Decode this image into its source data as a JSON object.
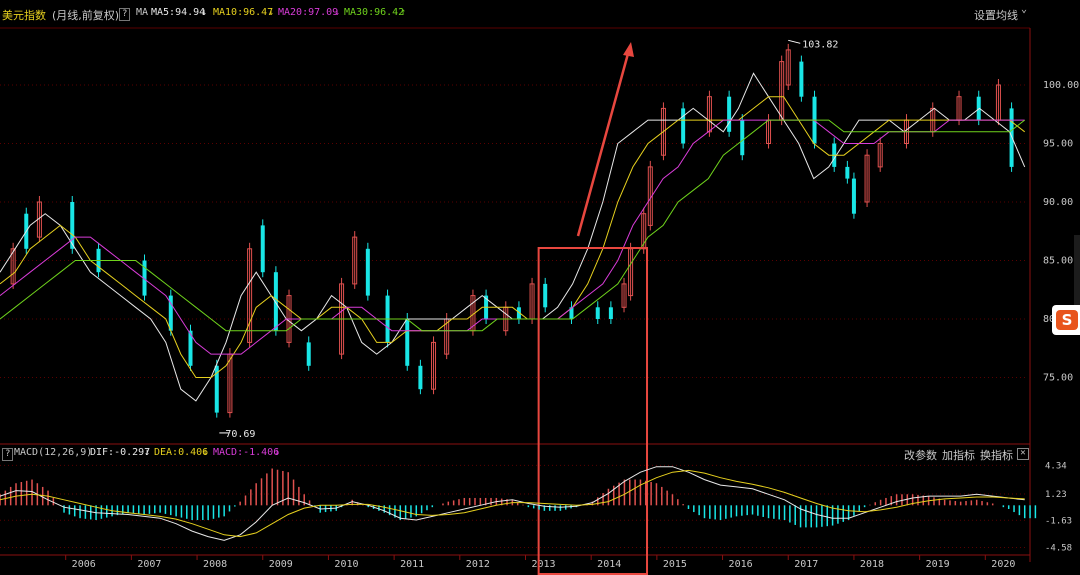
{
  "header": {
    "title": "美元指数",
    "subtitle": "(月线,前复权)",
    "help": "?",
    "ma_label": "MA",
    "ma5": "MA5:94.94",
    "ma10": "MA10:96.47",
    "ma20": "MA20:97.09",
    "ma30": "MA30:96.42",
    "ma5_arrow": "↓",
    "ma10_arrow": "↓",
    "ma20_arrow": "↓",
    "ma30_arrow": "↑",
    "settings": "设置均线",
    "settings_arrow": "⌄"
  },
  "macd_header": {
    "help": "?",
    "label": "MACD(12,26,9)",
    "dif": "DIF:-0.297",
    "dea": "DEA:0.406",
    "macd": "MACD:-1.406",
    "dif_arrow": "↓",
    "dea_arrow": "↓",
    "macd_arrow": "↓",
    "btn_params": "改参数",
    "btn_add": "加指标",
    "btn_swap": "换指标",
    "close": "✕"
  },
  "colors": {
    "up": "#e0514f",
    "down": "#19e6e6",
    "ma5": "#e8e8e8",
    "ma10": "#e6d01e",
    "ma20": "#d83cd8",
    "ma30": "#6fd21c",
    "dif": "#e8e8e8",
    "dea": "#e6d01e",
    "annotation": "#e8473f",
    "grid": "#5a0000",
    "text": "#c8c8c8"
  },
  "chart_data": [
    {
      "type": "candlestick",
      "title": "美元指数 (月线,前复权)",
      "yticks": [
        75.0,
        80.0,
        85.0,
        90.0,
        95.0,
        100.0
      ],
      "ytick_labels": [
        "75.00",
        "80.",
        "85.00",
        "90.00",
        "95.00",
        "100.00"
      ],
      "xticks": [
        "2006",
        "2007",
        "2008",
        "2009",
        "2010",
        "2011",
        "2012",
        "2013",
        "2014",
        "2015",
        "2016",
        "2017",
        "2018",
        "2019",
        "2020"
      ],
      "annotations": [
        {
          "label": "70.69",
          "kind": "low"
        },
        {
          "label": "103.82",
          "kind": "high"
        }
      ],
      "series": [
        {
          "name": "MA5",
          "values": [
            84,
            86,
            88,
            89,
            88,
            86,
            84,
            83,
            82,
            81,
            80,
            78,
            74,
            73,
            75,
            78,
            82,
            84,
            82,
            80,
            79,
            80,
            82,
            81,
            78,
            77,
            78,
            80,
            80,
            80,
            80,
            81,
            82,
            81,
            80,
            80,
            80,
            81,
            83,
            86,
            90,
            95,
            96,
            97,
            97,
            97,
            98,
            97,
            96,
            98,
            101,
            99,
            97,
            95,
            92,
            93,
            95,
            97,
            97,
            97,
            96,
            97,
            98,
            97,
            97,
            98,
            97,
            96,
            93
          ]
        },
        {
          "name": "MA10",
          "values": [
            83,
            84,
            86,
            87,
            88,
            87,
            85,
            84,
            83,
            82,
            81,
            80,
            77,
            75,
            75,
            76,
            78,
            81,
            82,
            81,
            80,
            80,
            81,
            81,
            80,
            78,
            78,
            79,
            79,
            79,
            80,
            80,
            81,
            81,
            81,
            80,
            80,
            80,
            81,
            83,
            86,
            90,
            93,
            95,
            96,
            97,
            97,
            97,
            97,
            97,
            98,
            99,
            99,
            97,
            95,
            94,
            94,
            95,
            96,
            97,
            97,
            97,
            97,
            97,
            97,
            97,
            97,
            97,
            96
          ]
        },
        {
          "name": "MA20",
          "values": [
            82,
            83,
            84,
            85,
            86,
            87,
            87,
            86,
            85,
            84,
            83,
            82,
            80,
            78,
            77,
            77,
            77,
            78,
            79,
            80,
            80,
            80,
            80,
            81,
            81,
            80,
            79,
            79,
            79,
            79,
            79,
            79,
            80,
            80,
            80,
            80,
            80,
            80,
            81,
            82,
            83,
            85,
            88,
            90,
            92,
            93,
            95,
            96,
            97,
            97,
            97,
            97,
            97,
            97,
            97,
            96,
            95,
            95,
            95,
            96,
            96,
            96,
            96,
            97,
            97,
            97,
            97,
            97,
            97
          ]
        },
        {
          "name": "MA30",
          "values": [
            80,
            81,
            82,
            83,
            84,
            85,
            85,
            85,
            85,
            85,
            84,
            83,
            82,
            81,
            80,
            79,
            79,
            79,
            79,
            79,
            80,
            80,
            80,
            80,
            80,
            80,
            80,
            80,
            79,
            79,
            79,
            79,
            79,
            80,
            80,
            80,
            80,
            80,
            80,
            81,
            82,
            83,
            85,
            87,
            88,
            90,
            91,
            92,
            94,
            95,
            96,
            97,
            97,
            97,
            97,
            97,
            96,
            96,
            96,
            96,
            96,
            96,
            96,
            96,
            96,
            96,
            96,
            96,
            97
          ]
        }
      ],
      "candles_up": [
        {
          "x": 2005.2,
          "o": 83,
          "c": 86
        },
        {
          "x": 2005.6,
          "o": 87,
          "c": 90
        },
        {
          "x": 2008.5,
          "o": 72,
          "c": 77
        },
        {
          "x": 2008.8,
          "o": 78,
          "c": 86
        },
        {
          "x": 2009.4,
          "o": 78,
          "c": 82
        },
        {
          "x": 2010.2,
          "o": 77,
          "c": 83
        },
        {
          "x": 2010.4,
          "o": 83,
          "c": 87
        },
        {
          "x": 2011.6,
          "o": 74,
          "c": 78
        },
        {
          "x": 2011.8,
          "o": 77,
          "c": 80
        },
        {
          "x": 2012.2,
          "o": 79,
          "c": 82
        },
        {
          "x": 2012.7,
          "o": 79,
          "c": 81
        },
        {
          "x": 2013.1,
          "o": 80,
          "c": 83
        },
        {
          "x": 2014.5,
          "o": 81,
          "c": 83
        },
        {
          "x": 2014.6,
          "o": 82,
          "c": 86
        },
        {
          "x": 2014.8,
          "o": 86,
          "c": 89
        },
        {
          "x": 2014.9,
          "o": 88,
          "c": 93
        },
        {
          "x": 2015.1,
          "o": 94,
          "c": 98
        },
        {
          "x": 2015.8,
          "o": 96,
          "c": 99
        },
        {
          "x": 2016.7,
          "o": 95,
          "c": 97
        },
        {
          "x": 2016.9,
          "o": 97,
          "c": 102
        },
        {
          "x": 2017.0,
          "o": 100,
          "c": 103
        },
        {
          "x": 2018.2,
          "o": 90,
          "c": 94
        },
        {
          "x": 2018.4,
          "o": 93,
          "c": 95
        },
        {
          "x": 2018.8,
          "o": 95,
          "c": 97
        },
        {
          "x": 2019.2,
          "o": 96,
          "c": 98
        },
        {
          "x": 2019.6,
          "o": 97,
          "c": 99
        },
        {
          "x": 2020.2,
          "o": 97,
          "c": 100
        }
      ],
      "candles_down": [
        {
          "x": 2005.4,
          "o": 89,
          "c": 86
        },
        {
          "x": 2006.1,
          "o": 90,
          "c": 86
        },
        {
          "x": 2006.5,
          "o": 86,
          "c": 84
        },
        {
          "x": 2007.2,
          "o": 85,
          "c": 82
        },
        {
          "x": 2007.6,
          "o": 82,
          "c": 79
        },
        {
          "x": 2007.9,
          "o": 79,
          "c": 76
        },
        {
          "x": 2008.3,
          "o": 76,
          "c": 72
        },
        {
          "x": 2009.0,
          "o": 88,
          "c": 84
        },
        {
          "x": 2009.2,
          "o": 84,
          "c": 79
        },
        {
          "x": 2009.7,
          "o": 78,
          "c": 76
        },
        {
          "x": 2010.6,
          "o": 86,
          "c": 82
        },
        {
          "x": 2010.9,
          "o": 82,
          "c": 78
        },
        {
          "x": 2011.2,
          "o": 80,
          "c": 76
        },
        {
          "x": 2011.4,
          "o": 76,
          "c": 74
        },
        {
          "x": 2012.4,
          "o": 82,
          "c": 80
        },
        {
          "x": 2012.9,
          "o": 81,
          "c": 80
        },
        {
          "x": 2013.3,
          "o": 83,
          "c": 81
        },
        {
          "x": 2013.7,
          "o": 81,
          "c": 80
        },
        {
          "x": 2014.1,
          "o": 81,
          "c": 80
        },
        {
          "x": 2014.3,
          "o": 81,
          "c": 80
        },
        {
          "x": 2015.4,
          "o": 98,
          "c": 95
        },
        {
          "x": 2016.1,
          "o": 99,
          "c": 96
        },
        {
          "x": 2016.3,
          "o": 97,
          "c": 94
        },
        {
          "x": 2017.2,
          "o": 102,
          "c": 99
        },
        {
          "x": 2017.4,
          "o": 99,
          "c": 95
        },
        {
          "x": 2017.7,
          "o": 95,
          "c": 93
        },
        {
          "x": 2017.9,
          "o": 93,
          "c": 92
        },
        {
          "x": 2018.0,
          "o": 92,
          "c": 89
        },
        {
          "x": 2019.9,
          "o": 99,
          "c": 97
        },
        {
          "x": 2020.4,
          "o": 98,
          "c": 93
        }
      ],
      "ma_x_start": 2005.0,
      "ma_x_end": 2020.6
    },
    {
      "type": "macd",
      "title": "MACD(12,26,9)",
      "yticks": [
        4.34,
        1.23,
        -1.63,
        -4.58
      ],
      "ytick_labels": [
        "4.34",
        "1.23",
        "-1.63",
        "-4.58"
      ],
      "dif": [
        1.0,
        1.6,
        1.5,
        0.6,
        -0.2,
        -0.5,
        -0.8,
        -0.9,
        -1.0,
        -1.2,
        -1.4,
        -2.0,
        -2.8,
        -3.4,
        -3.8,
        -3.2,
        -1.8,
        0.0,
        0.8,
        0.3,
        -0.4,
        -0.3,
        0.4,
        0.0,
        -0.6,
        -1.4,
        -1.6,
        -1.2,
        -0.8,
        -0.4,
        0.0,
        0.4,
        0.6,
        0.2,
        -0.1,
        -0.2,
        -0.1,
        0.3,
        1.3,
        2.6,
        3.6,
        4.2,
        4.2,
        3.6,
        2.8,
        2.2,
        2.0,
        1.8,
        1.2,
        0.6,
        -0.4,
        -1.0,
        -1.4,
        -1.4,
        -0.8,
        -0.2,
        0.4,
        0.8,
        1.0,
        1.0,
        1.0,
        1.2,
        1.0,
        0.8,
        0.6
      ],
      "dea": [
        0.6,
        1.0,
        1.2,
        1.0,
        0.6,
        0.2,
        -0.2,
        -0.6,
        -0.8,
        -1.0,
        -1.2,
        -1.5,
        -2.0,
        -2.6,
        -3.2,
        -3.4,
        -3.0,
        -2.0,
        -1.0,
        -0.3,
        0.0,
        0.0,
        0.1,
        0.1,
        -0.2,
        -0.6,
        -1.0,
        -1.1,
        -1.0,
        -0.8,
        -0.4,
        0.0,
        0.3,
        0.3,
        0.2,
        0.1,
        0.0,
        0.1,
        0.4,
        1.2,
        2.2,
        3.0,
        3.6,
        3.8,
        3.5,
        3.0,
        2.6,
        2.3,
        1.9,
        1.4,
        0.8,
        0.2,
        -0.3,
        -0.6,
        -0.7,
        -0.5,
        -0.2,
        0.2,
        0.5,
        0.7,
        0.8,
        0.9,
        0.9,
        0.8,
        0.7
      ],
      "hist": [
        1.2,
        2.4,
        2.8,
        1.6,
        -0.8,
        -1.4,
        -1.6,
        -1.2,
        -0.8,
        -1.0,
        -0.8,
        -1.2,
        -1.6,
        -1.6,
        -1.2,
        0.4,
        2.4,
        4.0,
        3.6,
        1.2,
        -0.8,
        -0.6,
        0.6,
        -0.2,
        -0.8,
        -1.6,
        -1.2,
        -0.2,
        0.4,
        0.8,
        0.8,
        0.8,
        0.6,
        -0.2,
        -0.6,
        -0.6,
        -0.2,
        0.4,
        1.8,
        2.8,
        2.8,
        2.4,
        1.2,
        -0.4,
        -1.4,
        -1.6,
        -1.2,
        -1.0,
        -1.4,
        -1.6,
        -2.4,
        -2.4,
        -2.2,
        -1.6,
        -0.2,
        0.6,
        1.2,
        1.2,
        1.0,
        0.6,
        0.4,
        0.6,
        0.2,
        -0.4,
        -1.4
      ]
    }
  ]
}
